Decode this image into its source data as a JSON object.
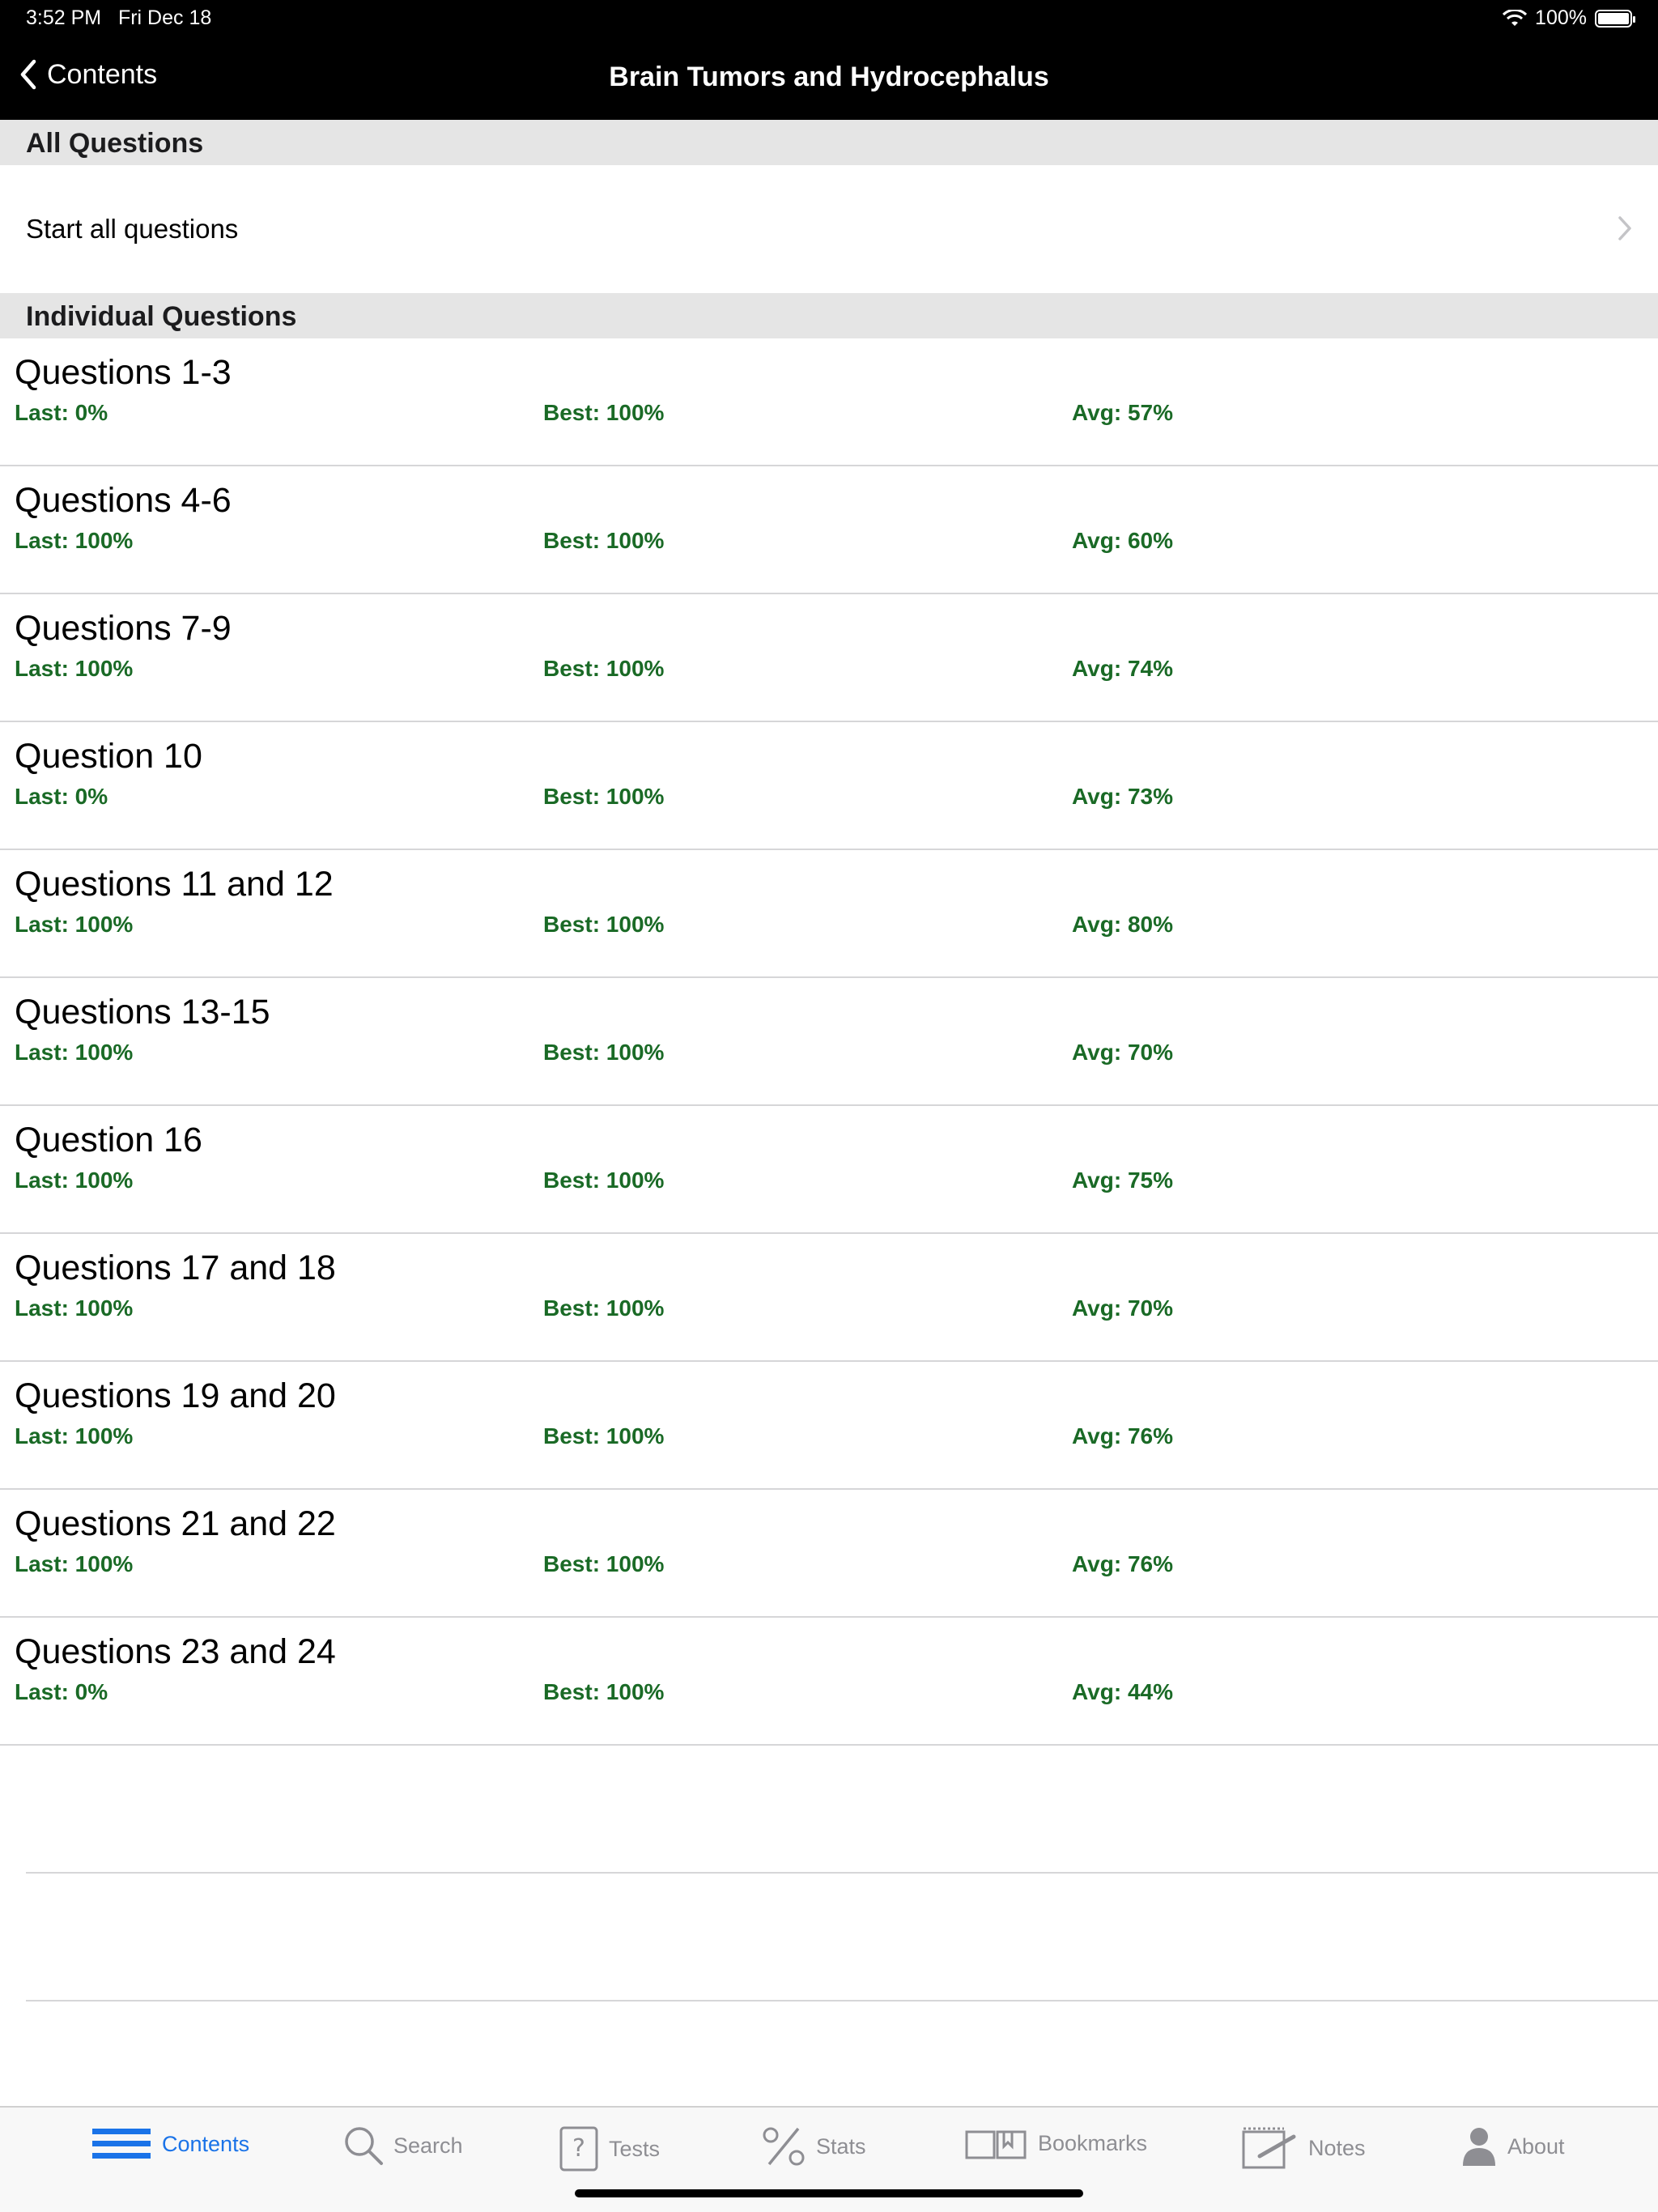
{
  "status": {
    "time": "3:52 PM",
    "date": "Fri Dec 18",
    "battery": "100%"
  },
  "nav": {
    "back_label": "Contents",
    "title": "Brain Tumors and Hydrocephalus"
  },
  "sections": {
    "all": "All Questions",
    "individual": "Individual Questions"
  },
  "start_all": "Start all questions",
  "questions": [
    {
      "title": "Questions 1-3",
      "last": "Last: 0%",
      "best": "Best: 100%",
      "avg": "Avg: 57%"
    },
    {
      "title": "Questions 4-6",
      "last": "Last: 100%",
      "best": "Best: 100%",
      "avg": "Avg: 60%"
    },
    {
      "title": "Questions 7-9",
      "last": "Last: 100%",
      "best": "Best: 100%",
      "avg": "Avg: 74%"
    },
    {
      "title": "Question 10",
      "last": "Last: 0%",
      "best": "Best: 100%",
      "avg": "Avg: 73%"
    },
    {
      "title": "Questions 11 and 12",
      "last": "Last: 100%",
      "best": "Best: 100%",
      "avg": "Avg: 80%"
    },
    {
      "title": "Questions 13-15",
      "last": "Last: 100%",
      "best": "Best: 100%",
      "avg": "Avg: 70%"
    },
    {
      "title": "Question 16",
      "last": "Last: 100%",
      "best": "Best: 100%",
      "avg": "Avg: 75%"
    },
    {
      "title": "Questions 17 and 18",
      "last": "Last: 100%",
      "best": "Best: 100%",
      "avg": "Avg: 70%"
    },
    {
      "title": "Questions 19 and 20",
      "last": "Last: 100%",
      "best": "Best: 100%",
      "avg": "Avg: 76%"
    },
    {
      "title": "Questions 21 and 22",
      "last": "Last: 100%",
      "best": "Best: 100%",
      "avg": "Avg: 76%"
    },
    {
      "title": "Questions 23 and 24",
      "last": "Last: 0%",
      "best": "Best: 100%",
      "avg": "Avg: 44%"
    }
  ],
  "tabs": [
    {
      "label": "Contents",
      "icon": "contents-icon",
      "active": true
    },
    {
      "label": "Search",
      "icon": "search-icon"
    },
    {
      "label": "Tests",
      "icon": "tests-icon"
    },
    {
      "label": "Stats",
      "icon": "stats-icon"
    },
    {
      "label": "Bookmarks",
      "icon": "bookmarks-icon"
    },
    {
      "label": "Notes",
      "icon": "notes-icon"
    },
    {
      "label": "About",
      "icon": "about-icon"
    }
  ],
  "colors": {
    "stat_green": "#1a6a26",
    "active_tab": "#1a73e8",
    "inactive_tab": "#8e8e93",
    "section_bg": "#e5e5e5"
  }
}
